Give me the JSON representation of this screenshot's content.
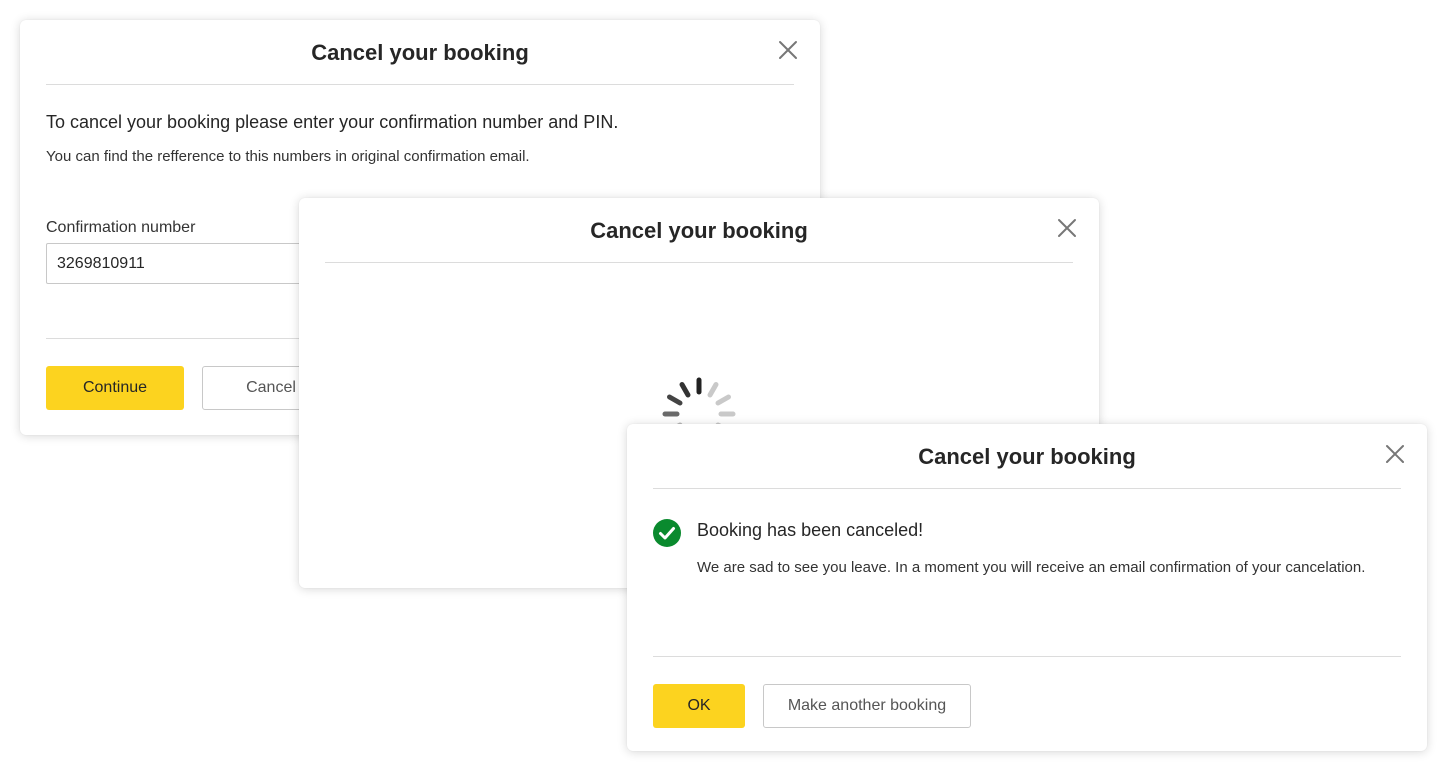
{
  "colors": {
    "accent": "#fcd31f",
    "success": "#0a8a2e",
    "divider": "#dcdcdc"
  },
  "modal_enter": {
    "title": "Cancel your booking",
    "close_icon": "close-icon",
    "lead": "To cancel your booking please enter your confirmation number and PIN.",
    "sub": "You can find the refference to this numbers in original confirmation email.",
    "confirmation_label": "Confirmation number",
    "confirmation_value": "3269810911",
    "continue_label": "Continue",
    "cancel_label": "Cancel"
  },
  "modal_loading": {
    "title": "Cancel your booking",
    "close_icon": "close-icon",
    "spinner_icon": "loading-spinner-icon"
  },
  "modal_success": {
    "title": "Cancel your booking",
    "close_icon": "close-icon",
    "status_icon": "check-circle-icon",
    "heading": "Booking has been canceled!",
    "message": "We are sad to see you leave. In a moment you will receive an email confirmation of your cancelation.",
    "ok_label": "OK",
    "another_label": "Make another booking"
  }
}
